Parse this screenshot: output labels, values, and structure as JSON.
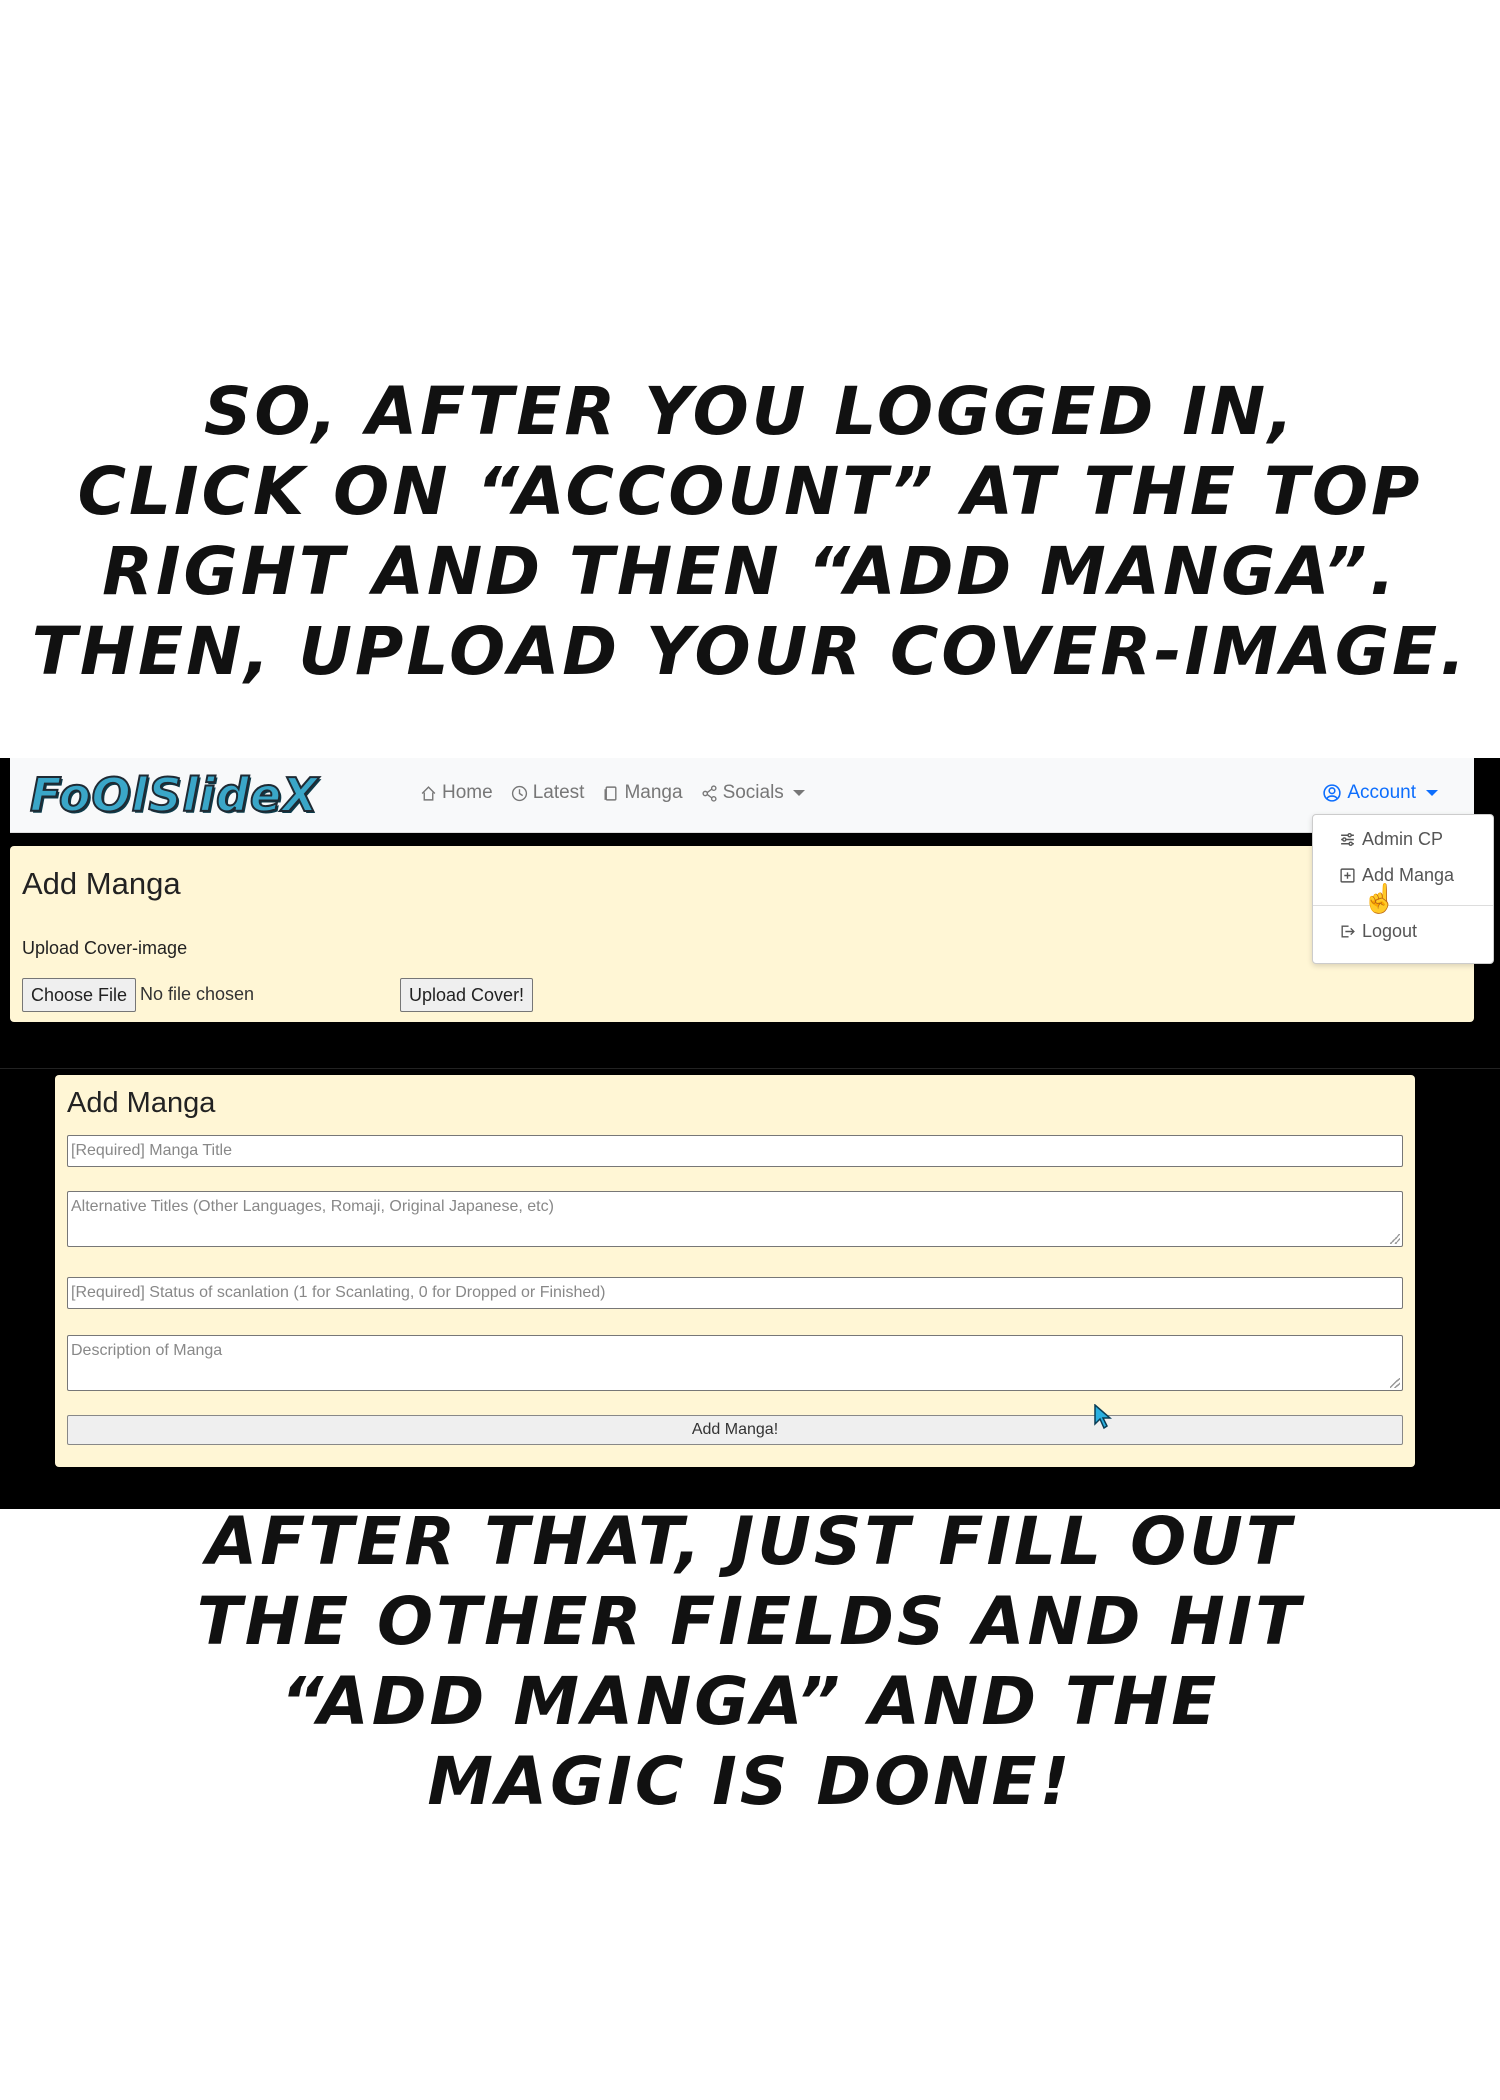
{
  "captions": {
    "top": [
      "So, after you logged in,",
      "click on “Account” at the top",
      "right and then “Add Manga”.",
      "Then, upload your cover-image."
    ],
    "bottom": [
      "After that, just fill out",
      "the other fields and hit",
      "“Add Manga” and the",
      "magic is done!"
    ]
  },
  "navbar": {
    "logo": "FoOlSlideX",
    "items": [
      {
        "label": "Home",
        "icon": "home-icon"
      },
      {
        "label": "Latest",
        "icon": "clock-icon"
      },
      {
        "label": "Manga",
        "icon": "copy-icon"
      },
      {
        "label": "Socials",
        "icon": "share-icon"
      }
    ],
    "account_label": "Account"
  },
  "dropdown": {
    "items": [
      {
        "label": "Admin CP",
        "icon": "sliders-icon"
      },
      {
        "label": "Add Manga",
        "icon": "plus-square-icon"
      },
      {
        "label": "Logout",
        "icon": "logout-icon"
      }
    ]
  },
  "upload_card": {
    "title": "Add Manga",
    "label": "Upload Cover-image",
    "choose_file": "Choose File",
    "no_file": "No file chosen",
    "upload_button": "Upload Cover!"
  },
  "form_card": {
    "title": "Add Manga",
    "title_placeholder": "[Required] Manga Title",
    "alt_titles_placeholder": "Alternative Titles (Other Languages, Romaji, Original Japanese, etc)",
    "status_placeholder": "[Required] Status of scanlation (1 for Scanlating, 0 for Dropped or Finished)",
    "description_placeholder": "Description of Manga",
    "submit_label": "Add Manga!"
  },
  "colors": {
    "card_bg": "#fff6d5",
    "link": "#0d6efd",
    "logo": "#3aa6c8"
  }
}
